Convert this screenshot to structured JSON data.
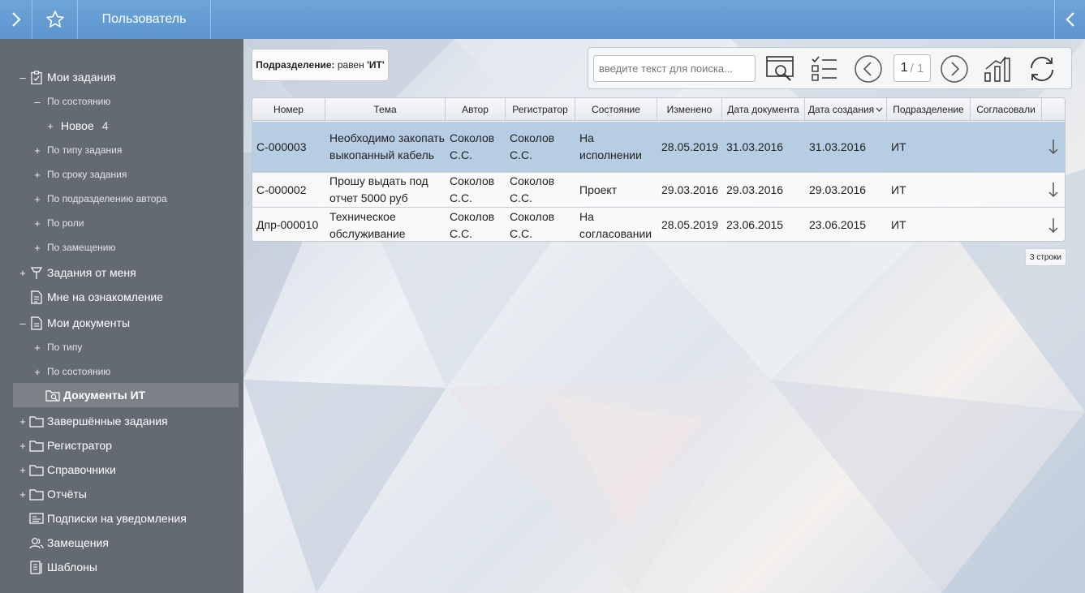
{
  "header": {
    "title": "Пользователь"
  },
  "sidebar": {
    "items": [
      {
        "toggle": "–",
        "icon": "clipboard-icon",
        "label": "Мои задания",
        "count": ""
      },
      {
        "toggle": "–",
        "icon": "",
        "label": "По состоянию",
        "count": ""
      },
      {
        "toggle": "+",
        "icon": "",
        "label": "Новое",
        "count": "4"
      },
      {
        "toggle": "+",
        "icon": "",
        "label": "По типу задания",
        "count": ""
      },
      {
        "toggle": "+",
        "icon": "",
        "label": "По сроку задания",
        "count": ""
      },
      {
        "toggle": "+",
        "icon": "",
        "label": "По подразделению автора",
        "count": ""
      },
      {
        "toggle": "+",
        "icon": "",
        "label": "По роли",
        "count": ""
      },
      {
        "toggle": "+",
        "icon": "",
        "label": "По замещению",
        "count": ""
      },
      {
        "toggle": "+",
        "icon": "pin-icon",
        "label": "Задания от меня",
        "count": ""
      },
      {
        "toggle": "",
        "icon": "document-list-icon",
        "label": "Мне на ознакомление",
        "count": ""
      },
      {
        "toggle": "–",
        "icon": "document-icon",
        "label": "Мои документы",
        "count": ""
      },
      {
        "toggle": "+",
        "icon": "",
        "label": "По типу",
        "count": ""
      },
      {
        "toggle": "+",
        "icon": "",
        "label": "По состоянию",
        "count": ""
      },
      {
        "toggle": "",
        "icon": "search-folder-icon",
        "label": "Документы ИТ",
        "count": ""
      },
      {
        "toggle": "+",
        "icon": "folder-icon",
        "label": "Завершённые задания",
        "count": ""
      },
      {
        "toggle": "+",
        "icon": "folder-icon",
        "label": "Регистратор",
        "count": ""
      },
      {
        "toggle": "+",
        "icon": "folder-icon",
        "label": "Справочники",
        "count": ""
      },
      {
        "toggle": "+",
        "icon": "folder-icon",
        "label": "Отчёты",
        "count": ""
      },
      {
        "toggle": "",
        "icon": "notification-icon",
        "label": "Подписки на уведомления",
        "count": ""
      },
      {
        "toggle": "",
        "icon": "users-icon",
        "label": "Замещения",
        "count": ""
      },
      {
        "toggle": "",
        "icon": "template-icon",
        "label": "Шаблоны",
        "count": ""
      }
    ]
  },
  "filter": {
    "field": "Подразделение:",
    "condition": "равен",
    "value": "'ИТ'"
  },
  "toolbar": {
    "search_placeholder": "введите текст для поиска...",
    "page_current": "1",
    "page_total": "/ 1"
  },
  "table": {
    "headers": [
      "Номер",
      "Тема",
      "Автор",
      "Регистратор",
      "Состояние",
      "Изменено",
      "Дата документа",
      "Дата создания",
      "Подразделение",
      "Согласовали"
    ],
    "rows": [
      [
        "С-000003",
        "Необходимо закопать выкопанный кабель",
        "Соколов С.С.",
        "Соколов С.С.",
        "На исполнении",
        "28.05.2019",
        "31.03.2016",
        "31.03.2016",
        "ИТ",
        ""
      ],
      [
        "С-000002",
        "Прошу выдать под отчет 5000 руб",
        "Соколов С.С.",
        "Соколов С.С.",
        "Проект",
        "29.03.2016",
        "29.03.2016",
        "29.03.2016",
        "ИТ",
        ""
      ],
      [
        "Дпр-000010",
        "Техническое обслуживание",
        "Соколов С.С.",
        "Соколов С.С.",
        "На согласовании",
        "28.05.2019",
        "23.06.2015",
        "23.06.2015",
        "ИТ",
        ""
      ]
    ],
    "row_count": "3 строки"
  },
  "colors": {
    "topbar": "#5b95cf",
    "sidebar": "#636a72",
    "selected_row": "#b7cde3"
  }
}
